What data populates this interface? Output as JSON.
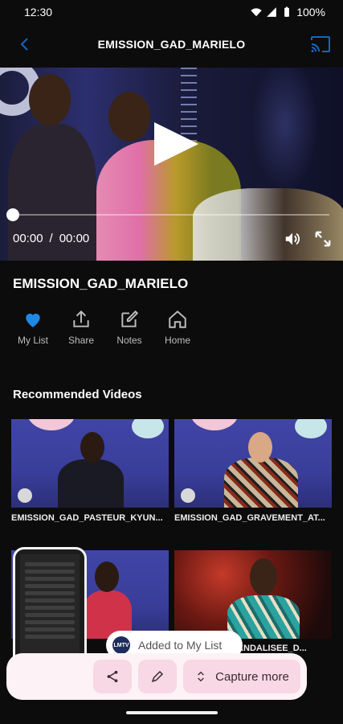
{
  "status_bar": {
    "time": "12:30",
    "battery": "100%"
  },
  "header": {
    "title": "EMISSION_GAD_MARIELO"
  },
  "player": {
    "current_time": "00:00",
    "separator": "/",
    "duration": "00:00",
    "progress": 0
  },
  "video": {
    "title": "EMISSION_GAD_MARIELO"
  },
  "actions": [
    {
      "label": "My List",
      "icon": "heart-icon"
    },
    {
      "label": "Share",
      "icon": "share-icon"
    },
    {
      "label": "Notes",
      "icon": "edit-icon"
    },
    {
      "label": "Home",
      "icon": "home-icon"
    }
  ],
  "recommended": {
    "title": "Recommended Videos",
    "items": [
      {
        "label": "EMISSION_GAD_PASTEUR_KYUN..."
      },
      {
        "label": "EMISSION_GAD_GRAVEMENT_AT..."
      },
      {
        "label": ""
      },
      {
        "label": "...RCANDALISEE_D..."
      }
    ]
  },
  "toast": {
    "logo": "LMTV",
    "text": "Added to My List"
  },
  "capture": {
    "capture_more_label": "Capture more"
  },
  "colors": {
    "accent": "#1e88e5",
    "header_icon": "#1565c0",
    "capture_bg": "#fdf2f6",
    "capture_btn": "#f8d8e4"
  }
}
